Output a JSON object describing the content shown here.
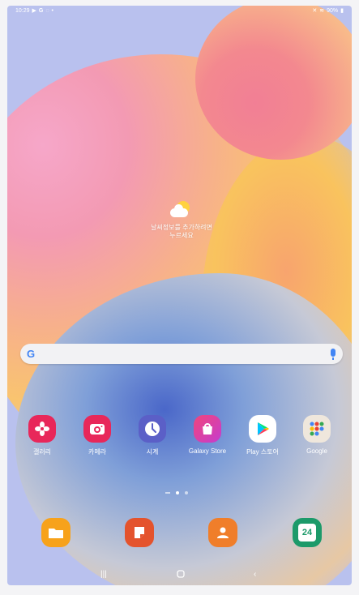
{
  "status_bar": {
    "time": "10:29",
    "left_icons": [
      "play-icon",
      "google-icon",
      "chat-icon",
      "dot-icon"
    ],
    "right_icons": [
      "no-signal-icon",
      "wifi-icon"
    ],
    "battery": "90%"
  },
  "weather": {
    "line1": "날씨정보를 추가하려면",
    "line2": "누르세요"
  },
  "search": {
    "logo": "G"
  },
  "apps": [
    {
      "label": "갤러리",
      "icon": "gallery-icon",
      "color": "#e8275a"
    },
    {
      "label": "카메라",
      "icon": "camera-icon",
      "color": "#e8275a"
    },
    {
      "label": "시계",
      "icon": "clock-icon",
      "color": "#5b5fc7"
    },
    {
      "label": "Galaxy Store",
      "icon": "galaxy-store-icon",
      "color": "#e23a8c"
    },
    {
      "label": "Play 스토어",
      "icon": "play-store-icon",
      "color": "#ffffff"
    },
    {
      "label": "Google",
      "icon": "google-folder-icon",
      "color": "#efe7dc"
    }
  ],
  "dock": [
    {
      "icon": "my-files-icon",
      "color": "#f7a21b"
    },
    {
      "icon": "samsung-notes-icon",
      "color": "#e4532d"
    },
    {
      "icon": "contacts-icon",
      "color": "#f07e2a"
    },
    {
      "icon": "calendar-icon",
      "color": "#1c9a6a",
      "text": "24"
    }
  ],
  "colors": {
    "wallpaper_base": "#b9c1ee",
    "accent_google": "#4285f4"
  }
}
